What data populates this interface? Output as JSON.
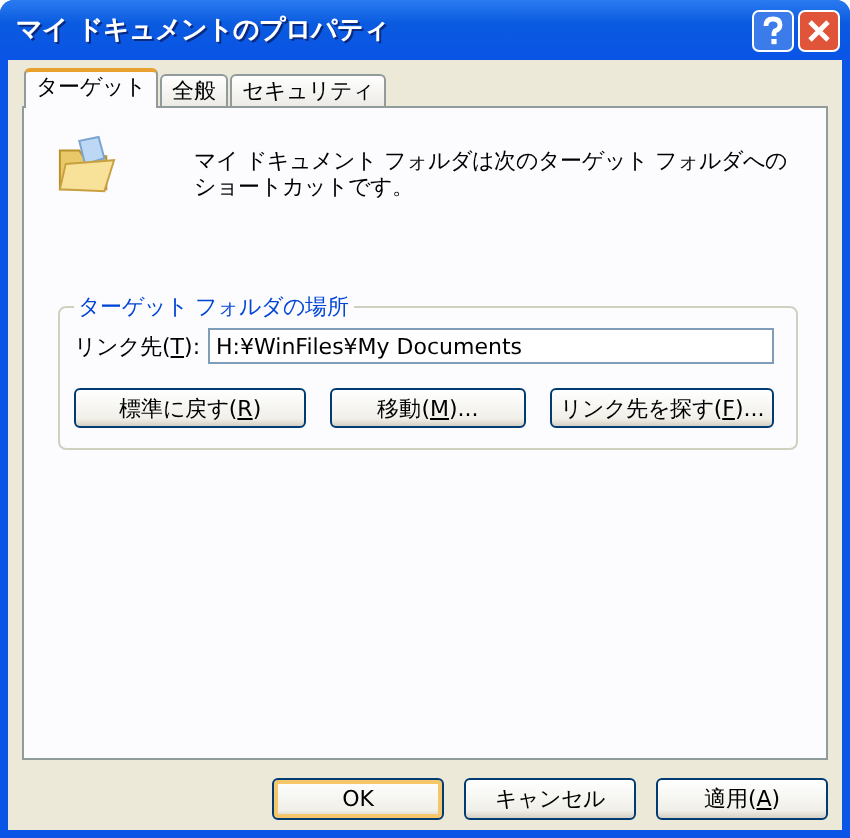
{
  "window": {
    "title": "マイ ドキュメントのプロパティ"
  },
  "tabs": [
    {
      "label": "ターゲット",
      "selected": true
    },
    {
      "label": "全般",
      "selected": false
    },
    {
      "label": "セキュリティ",
      "selected": false
    }
  ],
  "description": "マイ ドキュメント フォルダは次のターゲット フォルダへのショートカットです。",
  "group": {
    "title": "ターゲット フォルダの場所",
    "field": {
      "label": {
        "before": "リンク先(",
        "key": "T",
        "after": "):"
      },
      "value": "H:¥WinFiles¥My Documents"
    },
    "buttons": [
      {
        "before": "標準に戻す(",
        "key": "R",
        "after": ")"
      },
      {
        "before": "移動(",
        "key": "M",
        "after": ")..."
      },
      {
        "before": "リンク先を探す(",
        "key": "F",
        "after": ")..."
      }
    ]
  },
  "dialog_buttons": [
    {
      "before": "OK",
      "default": true
    },
    {
      "before": "キャンセル",
      "default": false
    },
    {
      "before": "適用(",
      "key": "A",
      "after": ")",
      "default": false
    }
  ]
}
